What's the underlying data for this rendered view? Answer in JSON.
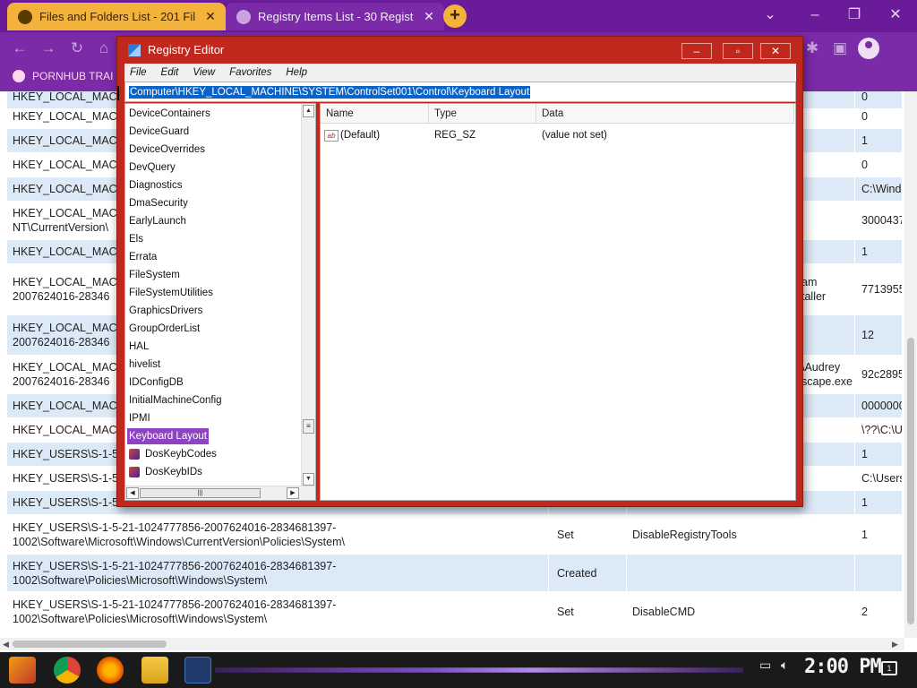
{
  "browser": {
    "tabs": [
      {
        "title": "Files and Folders List - 201 Fil",
        "active": false
      },
      {
        "title": "Registry Items List - 30 Regist",
        "active": true
      }
    ],
    "new_tab": "+",
    "bookmark": "PORNHUB TRAI"
  },
  "table": {
    "rows": [
      {
        "key": "HKEY_LOCAL_MACH",
        "action": "",
        "name": "",
        "value": "0",
        "shade": true
      },
      {
        "key": "HKEY_LOCAL_MACH",
        "action": "",
        "name": "",
        "value": "0",
        "shade": false
      },
      {
        "key": "HKEY_LOCAL_MACH",
        "action": "",
        "name": "",
        "value": "1",
        "shade": true
      },
      {
        "key": "HKEY_LOCAL_MACH",
        "action": "",
        "name": "",
        "value": "0",
        "shade": false
      },
      {
        "key": "HKEY_LOCAL_MACH",
        "action": "",
        "name": "",
        "value": "C:\\Wind",
        "shade": true
      },
      {
        "key": "HKEY_LOCAL_MACH\nNT\\CurrentVersion\\",
        "action": "",
        "name": "",
        "value": "3000437",
        "shade": false
      },
      {
        "key": "HKEY_LOCAL_MACH",
        "action": "",
        "name": "",
        "value": "1",
        "shade": true
      },
      {
        "key": "HKEY_LOCAL_MACH\n2007624016-28346",
        "action": "",
        "name": "am\ntaller",
        "value": "7713955",
        "shade": false
      },
      {
        "key": "HKEY_LOCAL_MACH\n2007624016-28346",
        "action": "",
        "name": "",
        "value": "12",
        "shade": true
      },
      {
        "key": "HKEY_LOCAL_MACH\n2007624016-28346",
        "action": "",
        "name": "\\Audrey\nscape.exe",
        "value": "92c2895",
        "shade": false
      },
      {
        "key": "HKEY_LOCAL_MACH",
        "action": "",
        "name": "",
        "value": "0000000",
        "shade": true
      },
      {
        "key": "HKEY_LOCAL_MACH",
        "action": "",
        "name": "",
        "value": "\\??\\C:\\U",
        "shade": false
      },
      {
        "key": "HKEY_USERS\\S-1-5",
        "action": "",
        "name": "",
        "value": "1",
        "shade": true
      },
      {
        "key": "HKEY_USERS\\S-1-5",
        "action": "",
        "name": "",
        "value": "C:\\Users",
        "shade": false
      },
      {
        "key": "HKEY_USERS\\S-1-5",
        "action": "",
        "name": "",
        "value": "1",
        "shade": true
      },
      {
        "key": "HKEY_USERS\\S-1-5-21-1024777856-2007624016-2834681397-\n1002\\Software\\Microsoft\\Windows\\CurrentVersion\\Policies\\System\\",
        "action": "Set",
        "name": "DisableRegistryTools",
        "value": "1",
        "shade": false
      },
      {
        "key": "HKEY_USERS\\S-1-5-21-1024777856-2007624016-2834681397-\n1002\\Software\\Policies\\Microsoft\\Windows\\System\\",
        "action": "Created",
        "name": "",
        "value": "",
        "shade": true
      },
      {
        "key": "HKEY_USERS\\S-1-5-21-1024777856-2007624016-2834681397-\n1002\\Software\\Policies\\Microsoft\\Windows\\System\\",
        "action": "Set",
        "name": "DisableCMD",
        "value": "2",
        "shade": false
      }
    ]
  },
  "regedit": {
    "title": "Registry Editor",
    "buttons": {
      "minimize": "–",
      "maximize": "▫",
      "close": "✕"
    },
    "menu": [
      "File",
      "Edit",
      "View",
      "Favorites",
      "Help"
    ],
    "address": "Computer\\HKEY_LOCAL_MACHINE\\SYSTEM\\ControlSet001\\Control\\Keyboard Layout",
    "tree": [
      {
        "label": "DeviceContainers",
        "selected": false,
        "child": false
      },
      {
        "label": "DeviceGuard",
        "selected": false,
        "child": false
      },
      {
        "label": "DeviceOverrides",
        "selected": false,
        "child": false
      },
      {
        "label": "DevQuery",
        "selected": false,
        "child": false
      },
      {
        "label": "Diagnostics",
        "selected": false,
        "child": false
      },
      {
        "label": "DmaSecurity",
        "selected": false,
        "child": false
      },
      {
        "label": "EarlyLaunch",
        "selected": false,
        "child": false
      },
      {
        "label": "Els",
        "selected": false,
        "child": false
      },
      {
        "label": "Errata",
        "selected": false,
        "child": false
      },
      {
        "label": "FileSystem",
        "selected": false,
        "child": false
      },
      {
        "label": "FileSystemUtilities",
        "selected": false,
        "child": false
      },
      {
        "label": "GraphicsDrivers",
        "selected": false,
        "child": false
      },
      {
        "label": "GroupOrderList",
        "selected": false,
        "child": false
      },
      {
        "label": "HAL",
        "selected": false,
        "child": false
      },
      {
        "label": "hivelist",
        "selected": false,
        "child": false
      },
      {
        "label": "IDConfigDB",
        "selected": false,
        "child": false
      },
      {
        "label": "InitialMachineConfig",
        "selected": false,
        "child": false
      },
      {
        "label": "IPMI",
        "selected": false,
        "child": false
      },
      {
        "label": "Keyboard Layout",
        "selected": true,
        "child": false
      },
      {
        "label": "DosKeybCodes",
        "selected": false,
        "child": true
      },
      {
        "label": "DosKeybIDs",
        "selected": false,
        "child": true
      }
    ],
    "columns": [
      "Name",
      "Type",
      "Data"
    ],
    "values": [
      {
        "icon": "ab",
        "name": "(Default)",
        "type": "REG_SZ",
        "data": "(value not set)"
      }
    ]
  },
  "taskbar": {
    "clock": "2:00 PM",
    "notifications": "1"
  },
  "colors": {
    "chrome_purple": "#7b2aa8",
    "tab_orange": "#f3b23a",
    "regedit_red": "#c0281e",
    "selection_blue": "#0a64c8",
    "tree_selection": "#8e44c2",
    "row_shade": "#dce9f6"
  }
}
